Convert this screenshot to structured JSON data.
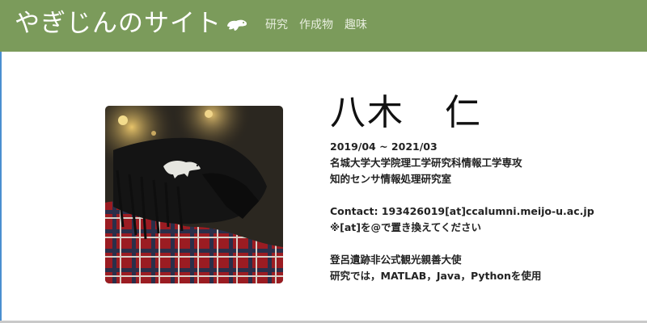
{
  "header": {
    "site_title": "やぎじんのサイト",
    "logo_icon": "ferret-icon",
    "nav": [
      {
        "label": "研究"
      },
      {
        "label": "作成物"
      },
      {
        "label": "趣味"
      }
    ]
  },
  "profile": {
    "name_family": "八木",
    "name_given": "仁",
    "photo": "profile-photo",
    "period": "2019/04 ~ 2021/03",
    "affiliation_1": "名城大学大学院理工学研究科情報工学専攻",
    "affiliation_2": "知的センサ情報処理研究室",
    "contact": "Contact: 193426019[at]ccalumni.meijo-u.ac.jp",
    "contact_note": "※[at]を@で置き換えてください",
    "ambassador": "登呂遺跡非公式観光親善大使",
    "research_tools": "研究では，MATLAB，Java，Pythonを使用"
  },
  "colors": {
    "navbar_bg": "#7b9b5b",
    "navbar_text": "#ffffff",
    "body_text": "#222222"
  }
}
